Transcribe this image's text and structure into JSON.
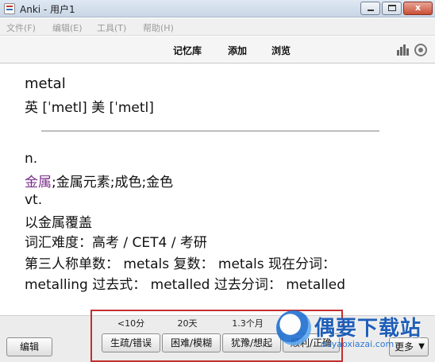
{
  "window": {
    "title": "Anki - 用户1",
    "close_glyph": "x"
  },
  "menu": {
    "items": [
      {
        "label": "文件(F)"
      },
      {
        "label": "编辑(E)"
      },
      {
        "label": "工具(T)"
      },
      {
        "label": "帮助(H)"
      }
    ]
  },
  "toolbar": {
    "links": [
      {
        "label": "记忆库"
      },
      {
        "label": "添加"
      },
      {
        "label": "浏览"
      }
    ],
    "icons": [
      "stats-icon",
      "sync-icon"
    ]
  },
  "card": {
    "word": "metal",
    "phonetic": "英 [ˈmetl]   美 [ˈmetl]",
    "pos1": "n.",
    "meaning1_highlight": "金属",
    "meaning1_rest": ";金属元素;成色;金色",
    "pos2": "vt.",
    "meaning2": "以金属覆盖",
    "difficulty": "词汇难度：高考 / CET4 / 考研",
    "forms_line1": "第三人称单数： metals 复数： metals 现在分词：",
    "forms_line2": "metalling 过去式： metalled 过去分词： metalled",
    "highlight_color": "#7b2f8a"
  },
  "bottom": {
    "edit_label": "编辑",
    "more_label": "更多",
    "more_caret": "▼",
    "answers": [
      {
        "interval": "<10分",
        "label": "生疏/错误"
      },
      {
        "interval": "20天",
        "label": "困难/模糊"
      },
      {
        "interval": "1.3个月",
        "label": "犹豫/想起"
      },
      {
        "interval": "",
        "label": "顺利/正确"
      }
    ],
    "highlight_color": "#c23030"
  },
  "watermark": {
    "text": "偶要下载站",
    "sub": "ouyaoxiazai.com"
  }
}
